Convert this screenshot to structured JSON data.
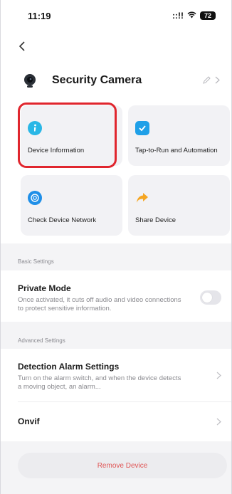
{
  "status_bar": {
    "time": "11:19",
    "signal": "::!!",
    "battery": "72"
  },
  "header": {
    "device_name": "Security Camera"
  },
  "tiles": [
    {
      "label": "Device Information",
      "icon": "info-icon",
      "color": "#2ab7e6"
    },
    {
      "label": "Tap-to-Run and Automation",
      "icon": "shield-check-icon",
      "color": "#1fa0e8"
    },
    {
      "label": "Check Device Network",
      "icon": "network-icon",
      "color": "#1f8fe8"
    },
    {
      "label": "Share Device",
      "icon": "share-arrow-icon",
      "color": "#f5a623"
    }
  ],
  "basic_settings": {
    "label": "Basic Settings",
    "private_mode": {
      "title": "Private Mode",
      "description": "Once activated, it cuts off audio and video connections to protect sensitive information.",
      "enabled": false
    }
  },
  "advanced_settings": {
    "label": "Advanced Settings",
    "detection_alarm": {
      "title": "Detection Alarm Settings",
      "description": "Turn on the alarm switch, and when the device detects a moving object, an alarm..."
    },
    "onvif": {
      "title": "Onvif"
    }
  },
  "remove_device": {
    "label": "Remove Device"
  },
  "colors": {
    "highlight": "#e0262e",
    "danger_text": "#e05555",
    "accent": "#1f8fe8"
  }
}
